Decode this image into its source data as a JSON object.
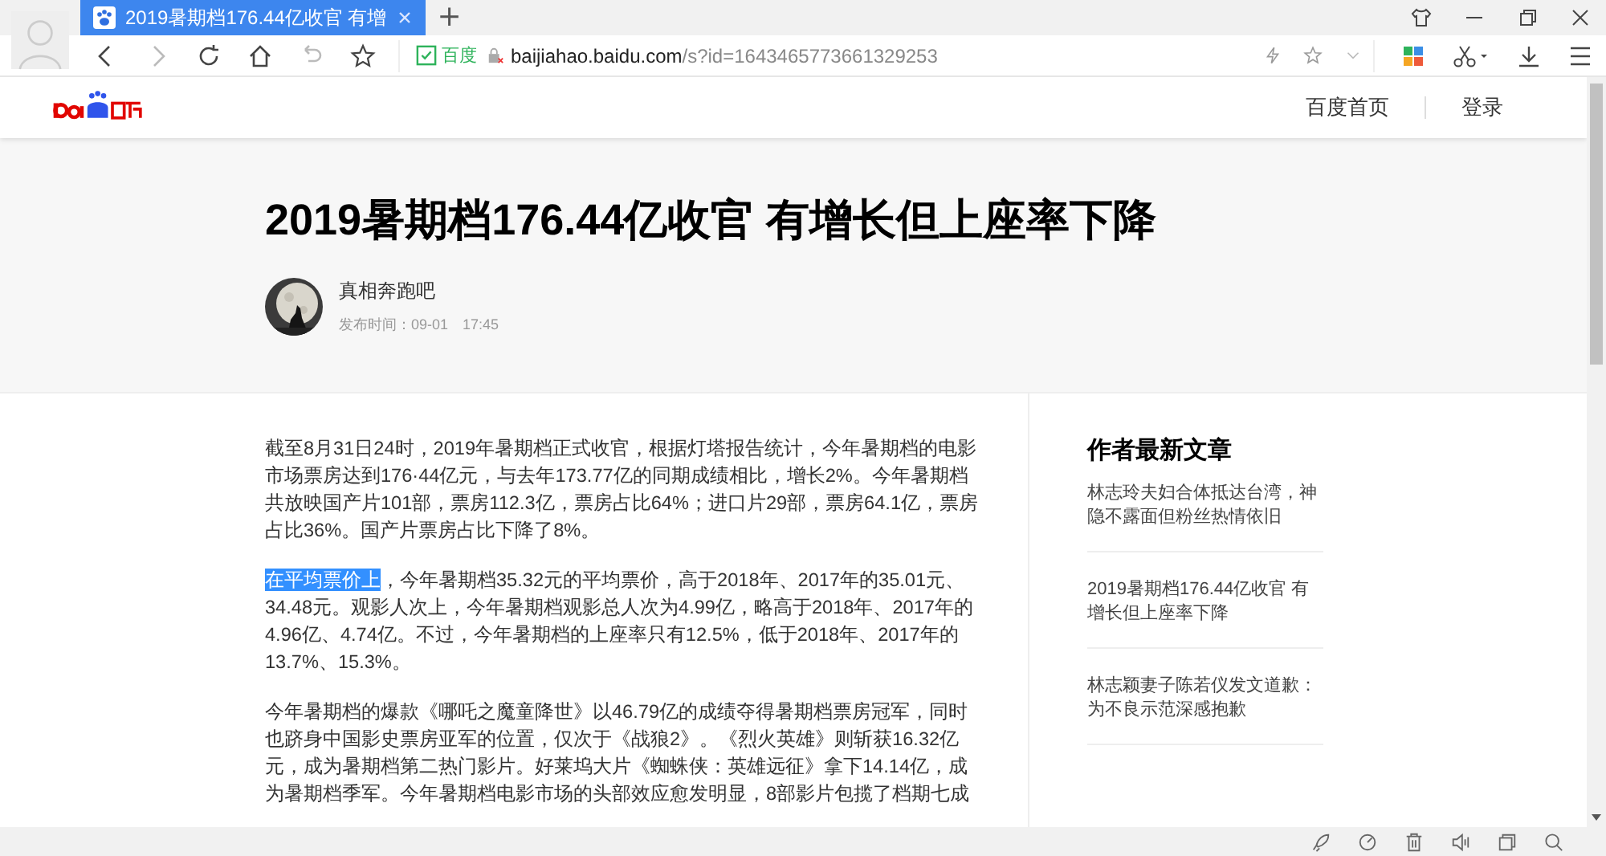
{
  "browser": {
    "tab": {
      "title": "2019暑期档176.44亿收官 有增",
      "selected": true
    },
    "new_tab": "+",
    "address": {
      "verified": "百度",
      "host": "baijiahao.baidu.com",
      "path": "/s?id=1643465773661329253"
    }
  },
  "site_header": {
    "nav": [
      {
        "label": "百度首页"
      },
      {
        "label": "登录"
      }
    ]
  },
  "article": {
    "title": "2019暑期档176.44亿收官 有增长但上座率下降",
    "author": "真相奔跑吧",
    "published": "发布时间：09-01　17:45",
    "paragraphs": [
      {
        "text": "截至8月31日24时，2019年暑期档正式收官，根据灯塔报告统计，今年暑期档的电影市场票房达到176·44亿元，与去年173.77亿的同期成绩相比，增长2%。今年暑期档共放映国产片101部，票房112.3亿，票房占比64%；进口片29部，票房64.1亿，票房占比36%。国产片票房占比下降了8%。"
      },
      {
        "selected_text": "在平均票价上",
        "text": "，今年暑期档35.32元的平均票价，高于2018年、2017年的35.01元、34.48元。观影人次上，今年暑期档观影总人次为4.99亿，略高于2018年、2017年的4.96亿、4.74亿。不过，今年暑期档的上座率只有12.5%，低于2018年、2017年的13.7%、15.3%。"
      },
      {
        "text": "今年暑期档的爆款《哪吒之魔童降世》以46.79亿的成绩夺得暑期档票房冠军，同时也跻身中国影史票房亚军的位置，仅次于《战狼2》。《烈火英雄》则斩获16.32亿元，成为暑期档第二热门影片。好莱坞大片《蜘蛛侠：英雄远征》拿下14.14亿，成为暑期档季军。今年暑期档电影市场的头部效应愈发明显，8部影片包揽了档期七成"
      }
    ]
  },
  "sidebar": {
    "heading": "作者最新文章",
    "articles": [
      {
        "title": "林志玲夫妇合体抵达台湾，神隐不露面但粉丝热情依旧"
      },
      {
        "title": "2019暑期档176.44亿收官 有增长但上座率下降"
      },
      {
        "title": "林志颖妻子陈若仪发文道歉：为不良示范深感抱歉"
      }
    ]
  }
}
